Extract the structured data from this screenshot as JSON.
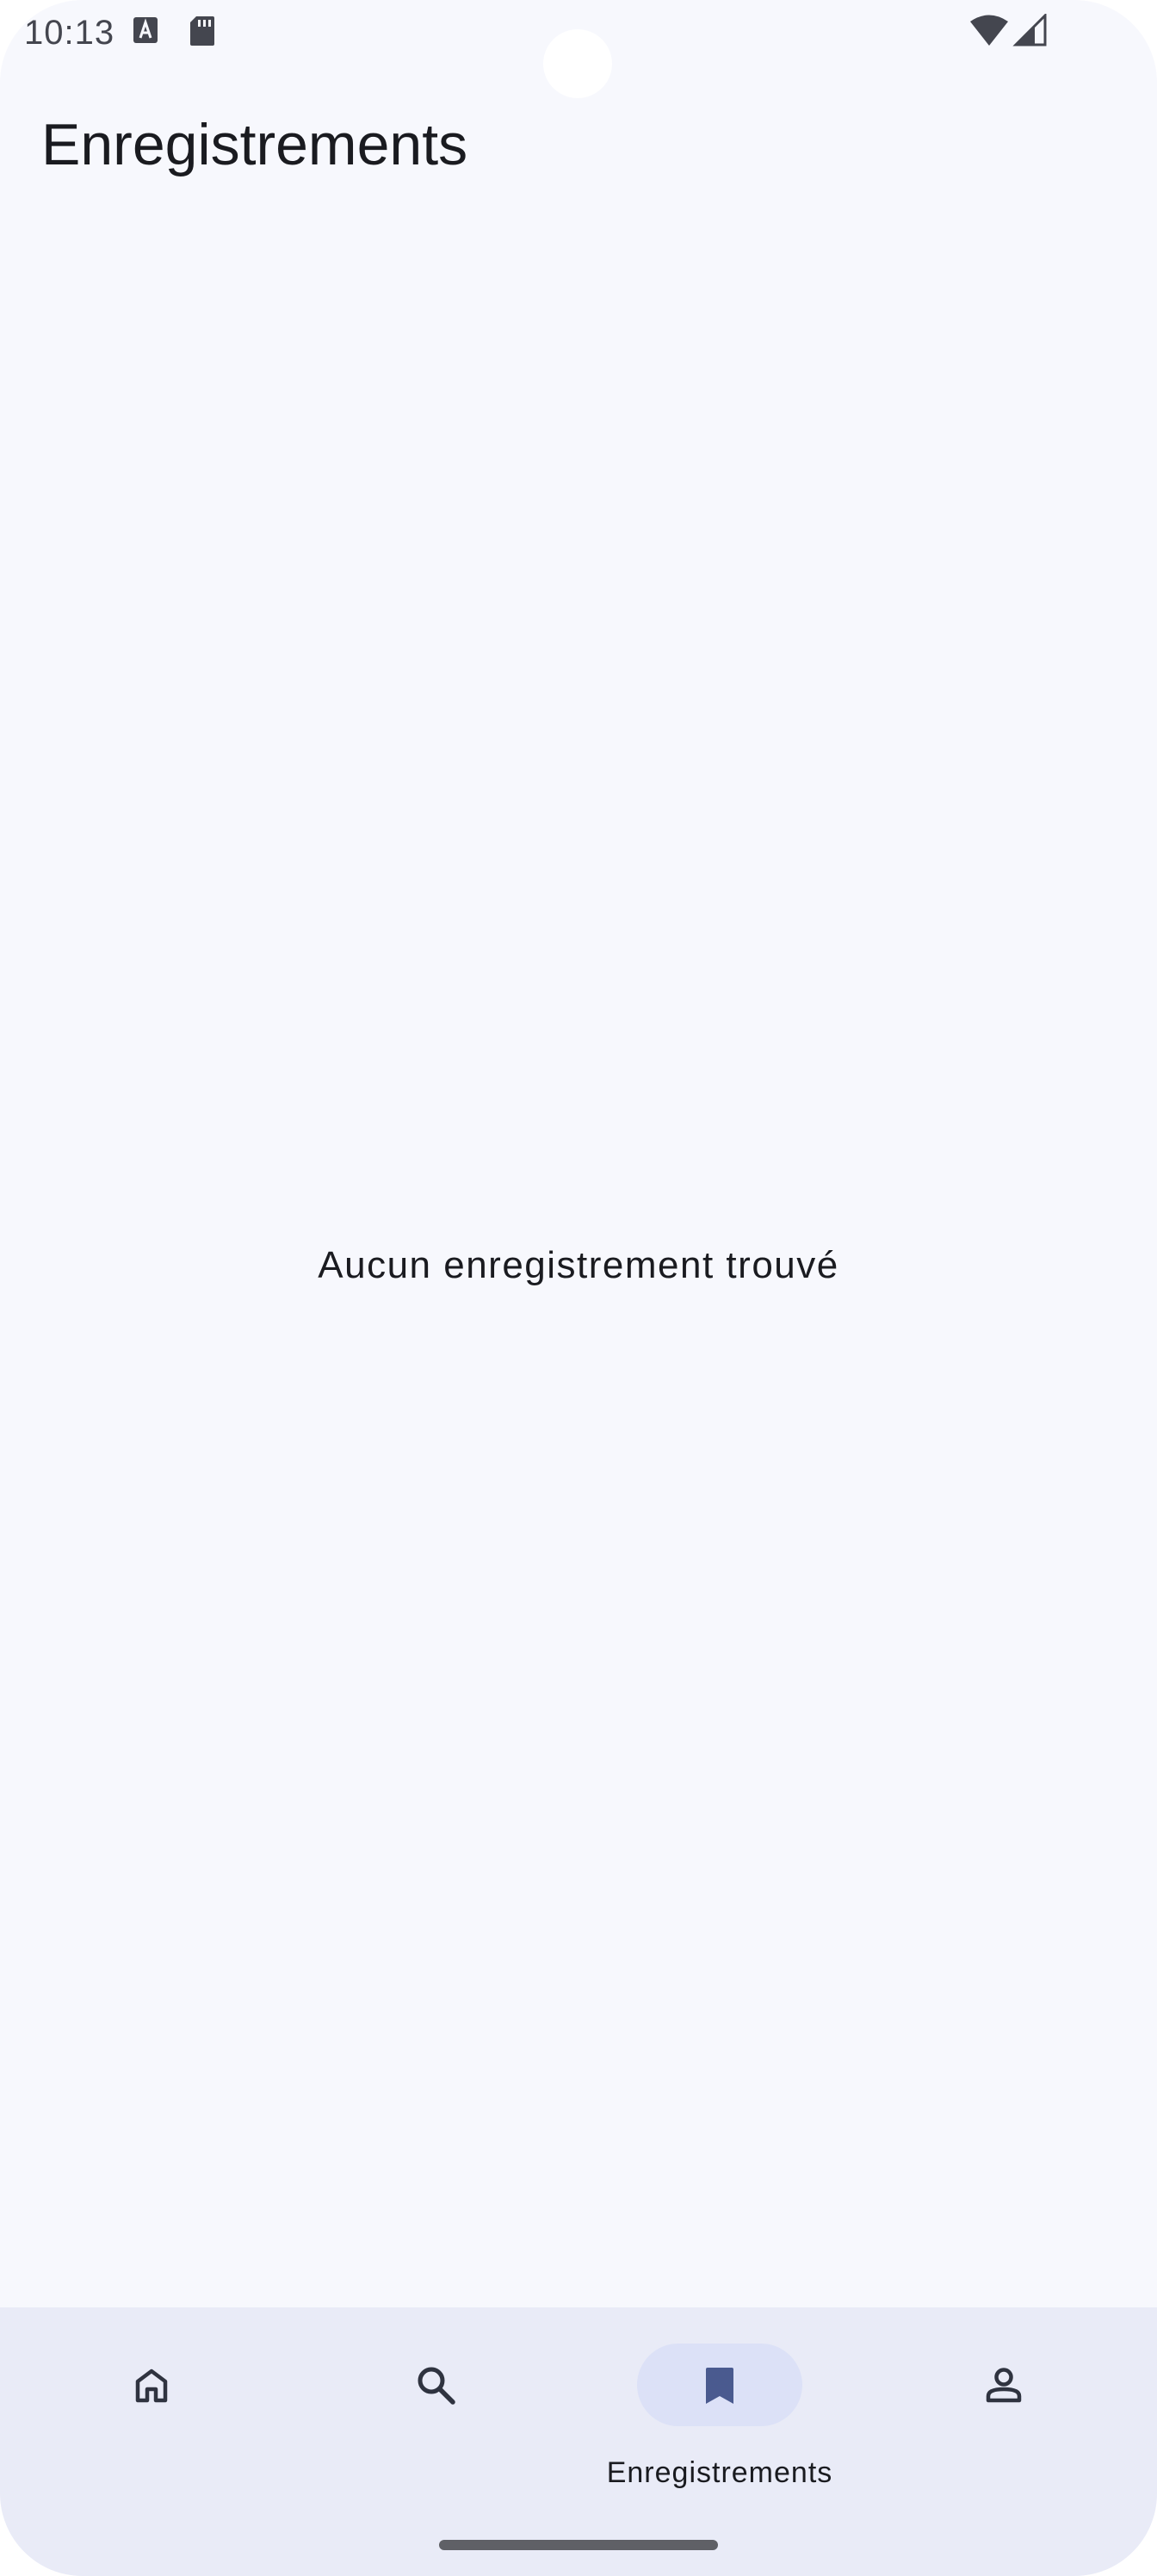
{
  "status_bar": {
    "time": "10:13",
    "icons": [
      "text-recognition-icon",
      "sd-card-icon",
      "wifi-icon",
      "cellular-signal-icon"
    ]
  },
  "header": {
    "title": "Enregistrements"
  },
  "main": {
    "empty_message": "Aucun enregistrement trouvé"
  },
  "bottom_nav": {
    "items": [
      {
        "icon": "home-icon",
        "label": "",
        "active": false
      },
      {
        "icon": "search-icon",
        "label": "",
        "active": false
      },
      {
        "icon": "bookmark-icon",
        "label": "Enregistrements",
        "active": true
      },
      {
        "icon": "profile-icon",
        "label": "",
        "active": false
      }
    ]
  },
  "colors": {
    "background": "#f7f8fd",
    "nav_background": "#e9ebf7",
    "active_indicator": "#dce1f7",
    "active_icon": "#4a5a8f",
    "inactive_icon": "#2f3340",
    "text": "#1a1b20"
  }
}
